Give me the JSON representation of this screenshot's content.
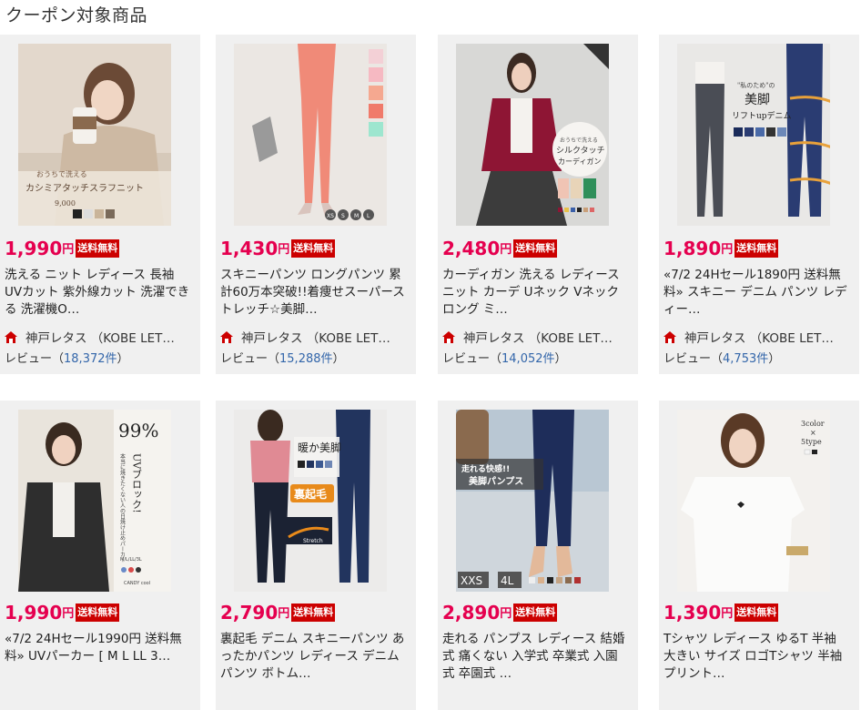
{
  "section_title": "クーポン対象商品",
  "colors": {
    "price": "#e5004f",
    "badge_bg": "#cc0000",
    "card_bg": "#f0f0f0",
    "review_link": "#3366aa",
    "shop_icon": "#cc0000"
  },
  "products": [
    {
      "price": "1,990",
      "yen": "円",
      "badge": "送料無料",
      "title": "洗える ニット レディース 長袖 UVカット 紫外線カット 洗濯できる 洗濯機O…",
      "shop": "神戸レタス （KOBE LET…",
      "review_label": "レビュー（",
      "review_count": "18,372件",
      "review_close": "）",
      "image_text": [
        "おうちで洗える",
        "カシミアタッチスラフニット",
        "9,000"
      ]
    },
    {
      "price": "1,430",
      "yen": "円",
      "badge": "送料無料",
      "title": "スキニーパンツ ロングパンツ 累計60万本突破!!着痩せスーパーストレッチ☆美脚…",
      "shop": "神戸レタス （KOBE LET…",
      "review_label": "レビュー（",
      "review_count": "15,288件",
      "review_close": "）",
      "image_text": [
        "XS",
        "S",
        "M",
        "L"
      ]
    },
    {
      "price": "2,480",
      "yen": "円",
      "badge": "送料無料",
      "title": "カーディガン 洗える レディース ニット カーデ Uネック Vネック ロング ミ…",
      "shop": "神戸レタス （KOBE LET…",
      "review_label": "レビュー（",
      "review_count": "14,052件",
      "review_close": "）",
      "image_text": [
        "おうちで洗える",
        "シルクタッチ",
        "カーディガン"
      ]
    },
    {
      "price": "1,890",
      "yen": "円",
      "badge": "送料無料",
      "title": "«7/2 24Hセール1890円 送料無料» スキニー デニム パンツ レディー…",
      "shop": "神戸レタス （KOBE LET…",
      "review_label": "レビュー（",
      "review_count": "4,753件",
      "review_close": "）",
      "image_text": [
        "\"私のため\"の",
        "美脚",
        "リフトupデニム"
      ]
    },
    {
      "price": "1,990",
      "yen": "円",
      "badge": "送料無料",
      "title": "«7/2 24Hセール1990円 送料無料» UVパーカー [ M L LL 3…",
      "image_text": [
        "99%",
        "UVブロック!",
        "本当に焼きたくない人の日焼け止めパーカー",
        "M/L/LL/3L",
        "CANDY cool"
      ]
    },
    {
      "price": "2,790",
      "yen": "円",
      "badge": "送料無料",
      "title": "裏起毛 デニム スキニーパンツ あったかパンツ レディース デニムパンツ ボトム…",
      "image_text": [
        "暖か美脚",
        "裏起毛",
        "Stretch"
      ]
    },
    {
      "price": "2,890",
      "yen": "円",
      "badge": "送料無料",
      "title": "走れる パンプス レディース 結婚式 痛くない 入学式 卒業式 入園式 卒園式 …",
      "image_text": [
        "走れる快感!!",
        "美脚パンプス",
        "XXS",
        "4L"
      ]
    },
    {
      "price": "1,390",
      "yen": "円",
      "badge": "送料無料",
      "title": "Tシャツ レディース ゆるT 半袖 大きい サイズ ロゴTシャツ 半袖 プリント…",
      "image_text": [
        "3color",
        "×",
        "5type"
      ]
    }
  ]
}
